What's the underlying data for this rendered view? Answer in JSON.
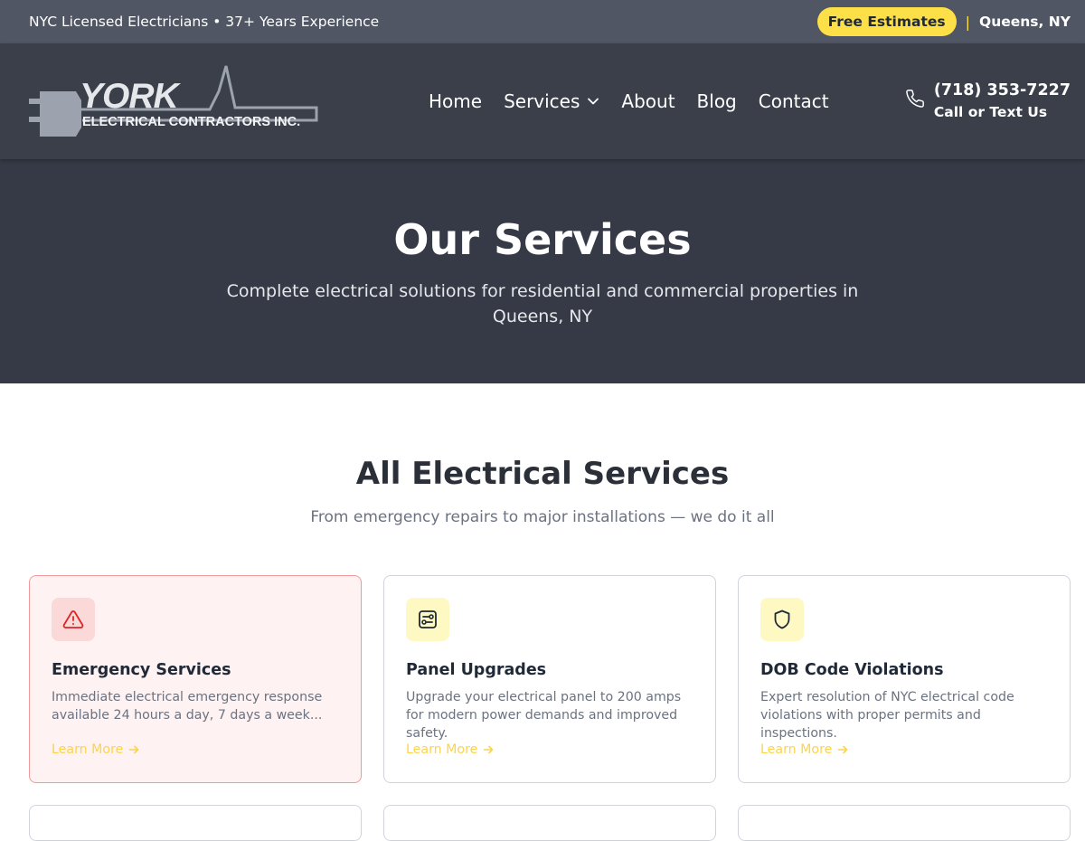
{
  "topbar": {
    "tagline": "NYC Licensed Electricians • 37+ Years Experience",
    "estimate_label": "Free Estimates",
    "separator": "|",
    "location": "Queens, NY"
  },
  "logo": {
    "word": "YORK",
    "subtitle": "ELECTRICAL CONTRACTORS INC."
  },
  "nav": {
    "items": [
      {
        "label": "Home"
      },
      {
        "label": "Services"
      },
      {
        "label": "About"
      },
      {
        "label": "Blog"
      },
      {
        "label": "Contact"
      }
    ]
  },
  "phone": {
    "number": "(718) 353-7227",
    "note": "Call or Text Us"
  },
  "hero": {
    "title": "Our Services",
    "subtitle": "Complete electrical solutions for residential and commercial properties in Queens, NY"
  },
  "section": {
    "title": "All Electrical Services",
    "subtitle": "From emergency repairs to major installations — we do it all"
  },
  "cards": [
    {
      "icon": "warning-triangle-icon",
      "title": "Emergency Services",
      "description": "Immediate electrical emergency response available 24 hours a day, 7 days a week...",
      "link": "Learn More"
    },
    {
      "icon": "electrical-panel-icon",
      "title": "Panel Upgrades",
      "description": "Upgrade your electrical panel to 200 amps for modern power demands and improved safety.",
      "link": "Learn More"
    },
    {
      "icon": "shield-icon",
      "title": "DOB Code Violations",
      "description": "Expert resolution of NYC electrical code violations with proper permits and inspections.",
      "link": "Learn More"
    }
  ],
  "colors": {
    "accent": "#fde047",
    "header_bg": "#3a3f4a",
    "topbar_bg": "#505664",
    "hero_bg": "#353a46",
    "emergency_red": "#dc2626"
  }
}
